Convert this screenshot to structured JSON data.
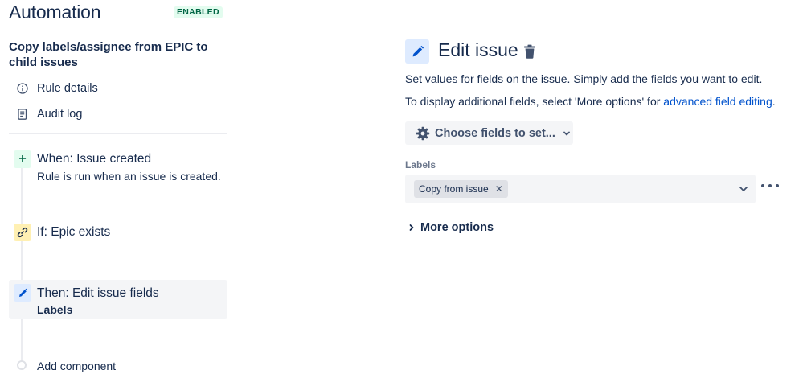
{
  "header": {
    "title": "Automation",
    "status": "ENABLED"
  },
  "rule": {
    "name": "Copy labels/assignee from EPIC to child issues"
  },
  "nav": {
    "rule_details": "Rule details",
    "audit_log": "Audit log"
  },
  "steps": {
    "when": {
      "title": "When: Issue created",
      "subtitle": "Rule is run when an issue is created."
    },
    "if": {
      "title": "If: Epic exists"
    },
    "then": {
      "title": "Then: Edit issue fields",
      "subtitle": "Labels"
    },
    "add": {
      "label": "Add component"
    }
  },
  "editor": {
    "title": "Edit issue",
    "desc1": "Set values for fields on the issue. Simply add the fields you want to edit.",
    "desc2_prefix": "To display additional fields, select 'More options' for ",
    "desc2_link": "advanced field editing",
    "desc2_suffix": ".",
    "choose_fields": "Choose fields to set...",
    "field_label": "Labels",
    "chip": "Copy from issue",
    "more_options": "More options"
  },
  "colors": {
    "accent_blue": "#0052cc",
    "enabled_green": "#006644",
    "enabled_bg": "#e3fcef",
    "condition_yellow": "#fff0b3",
    "action_blue_bg": "#deebff"
  }
}
